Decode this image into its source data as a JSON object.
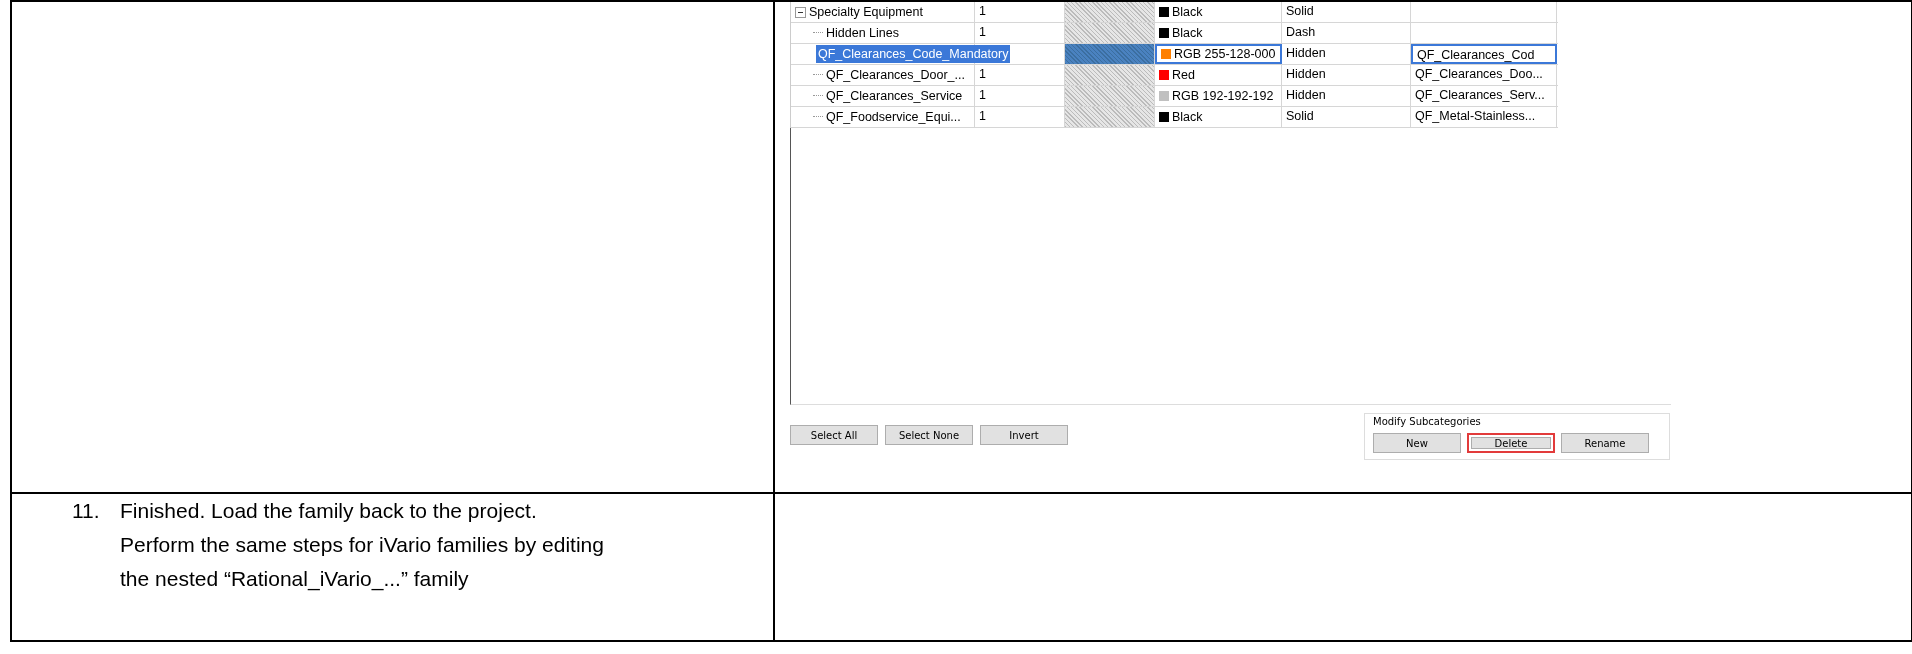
{
  "subcategories": {
    "rows": [
      {
        "name": "Specialty Equipment",
        "weight": "1",
        "color": "#000000",
        "color_label": "Black",
        "pattern": "Solid",
        "selected": false,
        "expanded": true,
        "children": [
          {
            "name": "Hidden Lines",
            "weight": "1",
            "color": "#000000",
            "color_label": "Black",
            "pattern": "Dash",
            "selected": false
          },
          {
            "name": "QF_Clearances_Code_Mandatory",
            "color": "#ff8000",
            "color_label": "RGB 255-128-000",
            "pattern": "Hidden",
            "material": "QF_Clearances_Cod",
            "selected": true
          },
          {
            "name": "QF_Clearances_Door_...",
            "weight": "1",
            "color": "#ff0000",
            "color_label": "Red",
            "pattern": "Hidden",
            "material": "QF_Clearances_Doo...",
            "selected": false
          },
          {
            "name": "QF_Clearances_Service",
            "weight": "1",
            "color": "#c0c0c0",
            "color_label": "RGB 192-192-192",
            "pattern": "Hidden",
            "material": "QF_Clearances_Serv...",
            "selected": false
          },
          {
            "name": "QF_Foodservice_Equi...",
            "weight": "1",
            "color": "#000000",
            "color_label": "Black",
            "pattern": "Solid",
            "material": "QF_Metal-Stainless...",
            "selected": false
          }
        ]
      }
    ]
  },
  "selection_buttons": [
    "Select All",
    "Select None",
    "Invert"
  ],
  "modify_group": {
    "title": "Modify Subcategories",
    "buttons": [
      {
        "label": "New",
        "highlighted": false
      },
      {
        "label": "Delete",
        "highlighted": true
      },
      {
        "label": "Rename",
        "highlighted": false
      }
    ]
  },
  "step": {
    "number": "11.",
    "lines": [
      "Finished. Load the family back to the project.",
      "Perform the same steps for iVario families by editing",
      "the nested “Rational_iVario_...” family"
    ]
  }
}
